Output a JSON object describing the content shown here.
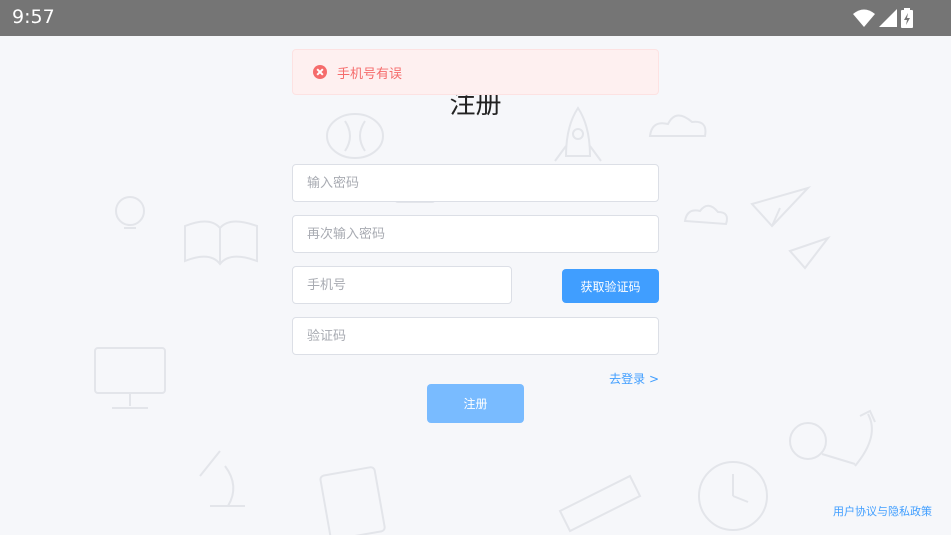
{
  "status_bar": {
    "time": "9:57",
    "icons": [
      "wifi-icon",
      "signal-icon",
      "battery-charging-icon"
    ]
  },
  "toast": {
    "message": "手机号有误",
    "color": "#f56c6c"
  },
  "page": {
    "title": "注册"
  },
  "form": {
    "password_placeholder": "输入密码",
    "confirm_password_placeholder": "再次输入密码",
    "phone_placeholder": "手机号",
    "code_placeholder": "验证码",
    "get_code_label": "获取验证码",
    "login_link": "去登录 >",
    "register_label": "注册"
  },
  "footer": {
    "policy_link": "用户协议与隐私政策"
  },
  "colors": {
    "accent": "#409eff",
    "register_button": "#79bbff",
    "status_bar": "#757575"
  }
}
